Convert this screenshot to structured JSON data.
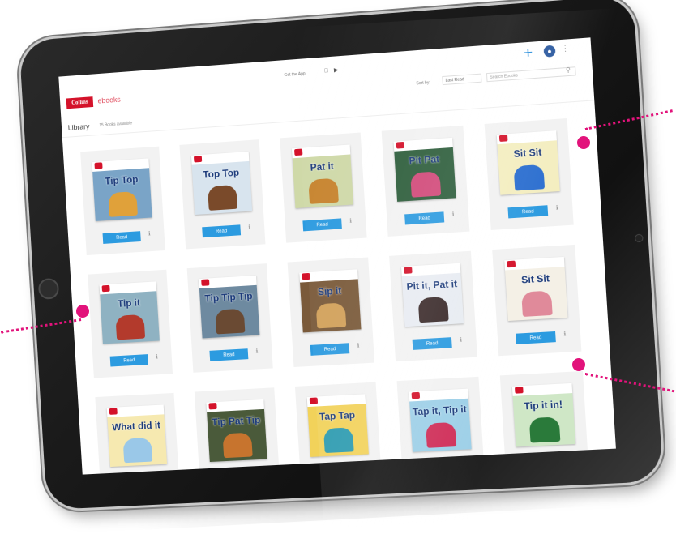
{
  "header": {
    "logo_text": "Collins",
    "app_name": "ebooks",
    "get_app_text": "Get the App",
    "sort_label": "Sort by:",
    "sort_value": "Last Read",
    "search_placeholder": "Search Ebooks"
  },
  "library": {
    "title": "Library",
    "count_text": "15 Books available"
  },
  "books": [
    {
      "title": "Tip Top",
      "cover_color": "#7aa4c7",
      "figure_color": "#e0a13a"
    },
    {
      "title": "Top Top",
      "cover_color": "#d8e4ee",
      "figure_color": "#7a4a2a"
    },
    {
      "title": "Pat it",
      "cover_color": "#cfd9a8",
      "figure_color": "#c7842e"
    },
    {
      "title": "Pit Pat",
      "cover_color": "#2e5e3c",
      "figure_color": "#d24a7a"
    },
    {
      "title": "Sit Sit",
      "cover_color": "#f4eec0",
      "figure_color": "#2c6fd0"
    },
    {
      "title": "Tip it",
      "cover_color": "#8fb2c2",
      "figure_color": "#b33a2c"
    },
    {
      "title": "Tip Tip Tip",
      "cover_color": "#6e8aa0",
      "figure_color": "#6a4a33"
    },
    {
      "title": "Sip it",
      "cover_color": "#7a5a3a",
      "figure_color": "#d2a15a"
    },
    {
      "title": "Pit it, Pat it",
      "cover_color": "#e8ecf2",
      "figure_color": "#3a2a2a"
    },
    {
      "title": "Sit Sit",
      "cover_color": "#f4f0e6",
      "figure_color": "#e08a9a"
    },
    {
      "title": "What did it",
      "cover_color": "#f6e9b0",
      "figure_color": "#9ac8e8"
    },
    {
      "title": "Tip Pat Tip",
      "cover_color": "#4a5a3a",
      "figure_color": "#c7742e"
    },
    {
      "title": "Tap Tap",
      "cover_color": "#f2d25a",
      "figure_color": "#2c9bb0"
    },
    {
      "title": "Tap it, Tip it",
      "cover_color": "#9ed0e8",
      "figure_color": "#d0305a"
    },
    {
      "title": "Tip it in!",
      "cover_color": "#cfe7c6",
      "figure_color": "#2a7a3a"
    }
  ],
  "read_label": "Read"
}
